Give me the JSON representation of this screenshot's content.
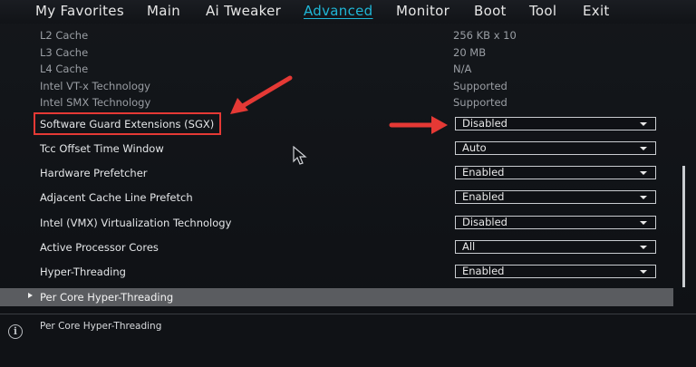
{
  "menu": {
    "items": [
      {
        "label": "My Favorites"
      },
      {
        "label": "Main"
      },
      {
        "label": "Ai Tweaker"
      },
      {
        "label": "Advanced",
        "active": true
      },
      {
        "label": "Monitor"
      },
      {
        "label": "Boot"
      },
      {
        "label": "Tool"
      },
      {
        "label": "Exit"
      }
    ]
  },
  "info_rows": [
    {
      "label": "L2 Cache",
      "value": "256 KB x 10"
    },
    {
      "label": "L3 Cache",
      "value": "20 MB"
    },
    {
      "label": "L4 Cache",
      "value": "N/A"
    },
    {
      "label": "Intel VT-x Technology",
      "value": "Supported"
    },
    {
      "label": "Intel SMX Technology",
      "value": "Supported"
    }
  ],
  "settings": [
    {
      "label": "Software Guard Extensions (SGX)",
      "value": "Disabled"
    },
    {
      "label": "Tcc Offset Time Window",
      "value": "Auto"
    },
    {
      "label": "Hardware Prefetcher",
      "value": "Enabled"
    },
    {
      "label": "Adjacent Cache Line Prefetch",
      "value": "Enabled"
    },
    {
      "label": "Intel (VMX) Virtualization Technology",
      "value": "Disabled"
    },
    {
      "label": "Active Processor Cores",
      "value": "All"
    },
    {
      "label": "Hyper-Threading",
      "value": "Enabled"
    }
  ],
  "submenu": {
    "label": "Per Core Hyper-Threading"
  },
  "help": {
    "icon": "info-icon",
    "glyph": "i",
    "text": "Per Core Hyper-Threading"
  },
  "colors": {
    "accent": "#1fb6d6",
    "annotation": "#e53935",
    "selected_row": "#5a5c60"
  }
}
